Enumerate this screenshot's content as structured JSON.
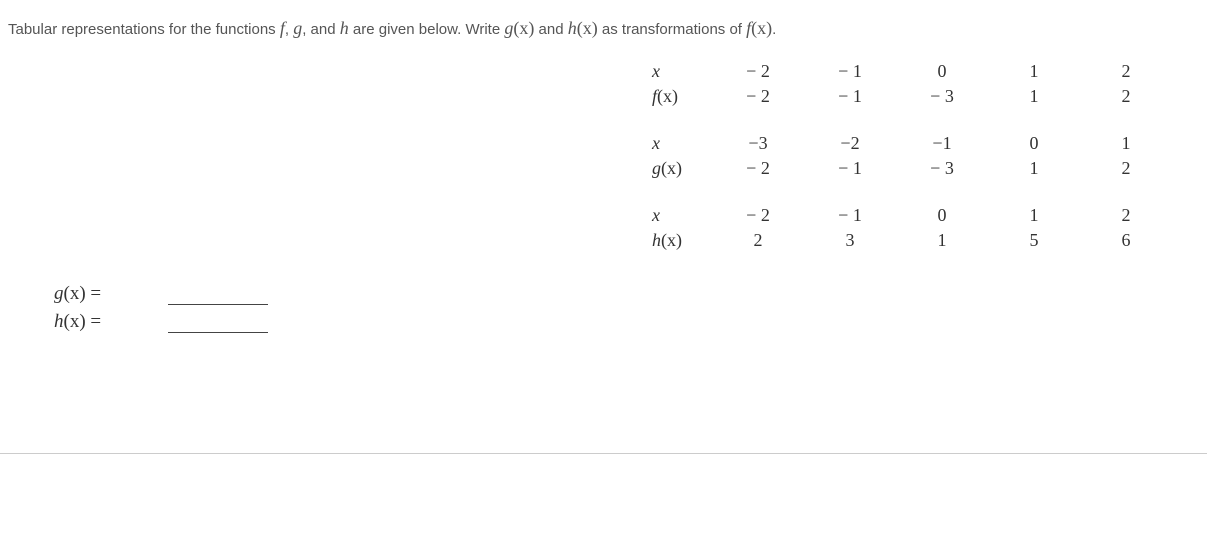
{
  "prompt": {
    "p1": "Tabular representations for the functions ",
    "f": "f",
    "c1": ", ",
    "g": "g",
    "c2": ", and ",
    "h": "h",
    "p2": " are given below. Write ",
    "gx": "g",
    "gxp": "(x)",
    "p3": " and ",
    "hx": "h",
    "hxp": "(x)",
    "p4": " as transformations of ",
    "fx": "f",
    "fxp": "(x)",
    "p5": "."
  },
  "table_f": {
    "rowvar_label": "x",
    "rowfn_label": "f",
    "paren": "(x)",
    "x": [
      "− 2",
      "− 1",
      "0",
      "1",
      "2"
    ],
    "fx": [
      "− 2",
      "− 1",
      "− 3",
      "1",
      "2"
    ]
  },
  "table_g": {
    "rowvar_label": "x",
    "rowfn_label": "g",
    "paren": "(x)",
    "x": [
      "−3",
      "−2",
      "−1",
      "0",
      "1"
    ],
    "gx": [
      "− 2",
      "− 1",
      "− 3",
      "1",
      "2"
    ]
  },
  "table_h": {
    "rowvar_label": "x",
    "rowfn_label": "h",
    "paren": "(x)",
    "x": [
      "− 2",
      "− 1",
      "0",
      "1",
      "2"
    ],
    "hx": [
      "2",
      "3",
      "1",
      "5",
      "6"
    ]
  },
  "answers": {
    "g_label": "g",
    "g_paren": "(x) =",
    "h_label": "h",
    "h_paren": "(x) ="
  }
}
